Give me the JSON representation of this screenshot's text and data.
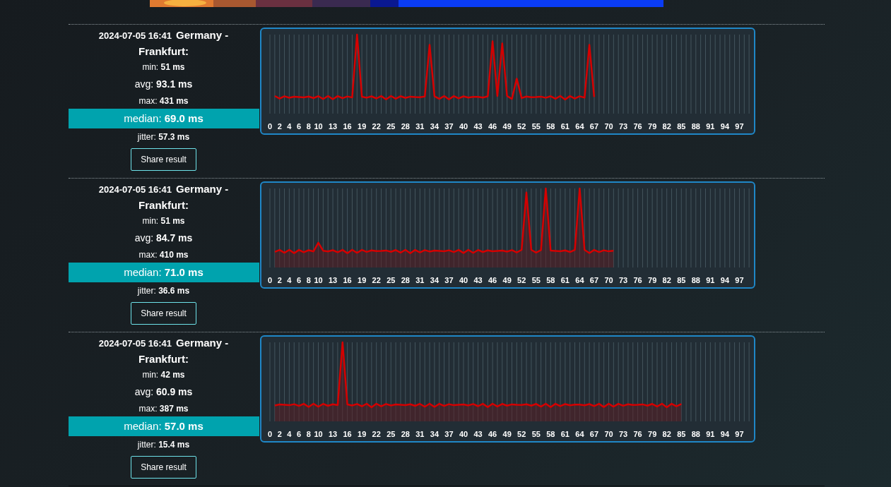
{
  "results": [
    {
      "time": "2024-07-05 16:41",
      "location": "Germany - Frankfurt:",
      "min": "min: **51 ms**",
      "avg": "avg: **93.1 ms**",
      "max": "max: **431 ms**",
      "median": "median: **69.0 ms**",
      "jitter": "jitter: **57.3 ms**",
      "button": "Share result",
      "chart": {
        "fill_area": false,
        "x_labels": [
          "0",
          "2",
          "4",
          "6",
          "8",
          "10",
          "13",
          "16",
          "19",
          "22",
          "25",
          "28",
          "31",
          "34",
          "37",
          "40",
          "43",
          "46",
          "49",
          "52",
          "55",
          "58",
          "61",
          "64",
          "67",
          "70",
          "73",
          "76",
          "79",
          "82",
          "85",
          "88",
          "91",
          "94",
          "97"
        ]
      }
    },
    {
      "time": "2024-07-05 16:41",
      "location": "Germany - Frankfurt:",
      "min": "min: **51 ms**",
      "avg": "avg: **84.7 ms**",
      "max": "max: **410 ms**",
      "median": "median: **71.0 ms**",
      "jitter": "jitter: **36.6 ms**",
      "button": "Share result",
      "chart": {
        "fill_area": true,
        "x_labels": [
          "0",
          "2",
          "4",
          "6",
          "8",
          "10",
          "13",
          "16",
          "19",
          "22",
          "25",
          "28",
          "31",
          "34",
          "37",
          "40",
          "43",
          "46",
          "49",
          "52",
          "55",
          "58",
          "61",
          "64",
          "67",
          "70",
          "73",
          "76",
          "79",
          "82",
          "85",
          "88",
          "91",
          "94",
          "97"
        ]
      }
    },
    {
      "time": "2024-07-05 16:41",
      "location": "Germany - Frankfurt:",
      "min": "min: **42 ms**",
      "avg": "avg: **60.9 ms**",
      "max": "max: **387 ms**",
      "median": "median: **57.0 ms**",
      "jitter": "jitter: **15.4 ms**",
      "button": "Share result",
      "chart": {
        "fill_area": true,
        "x_labels": [
          "0",
          "2",
          "4",
          "6",
          "8",
          "10",
          "13",
          "16",
          "19",
          "22",
          "25",
          "28",
          "31",
          "34",
          "37",
          "40",
          "43",
          "46",
          "49",
          "52",
          "55",
          "58",
          "61",
          "64",
          "67",
          "70",
          "73",
          "76",
          "79",
          "82",
          "85",
          "88",
          "91",
          "94",
          "97"
        ]
      }
    }
  ]
}
